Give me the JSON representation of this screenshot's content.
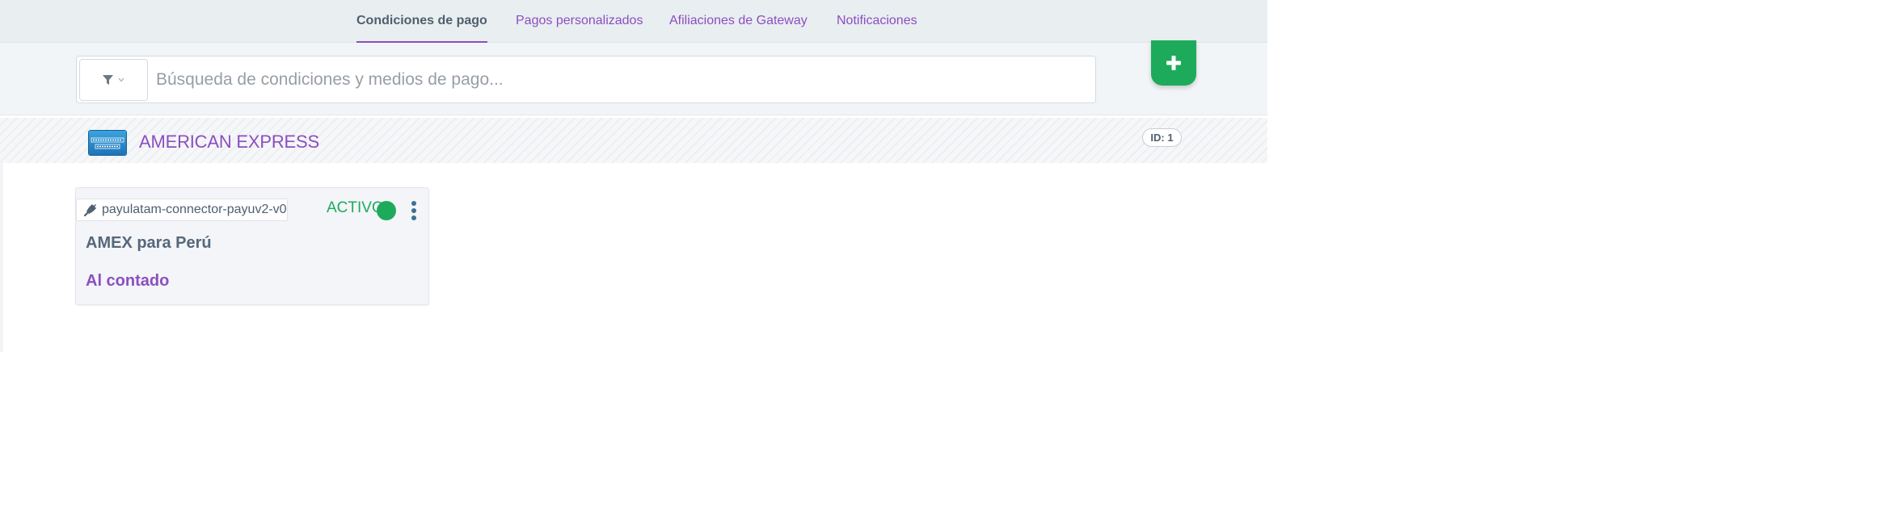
{
  "nav": {
    "tabs": [
      {
        "label": "Condiciones de pago",
        "active": true
      },
      {
        "label": "Pagos personalizados",
        "active": false
      },
      {
        "label": "Afiliaciones de Gateway",
        "active": false
      },
      {
        "label": "Notificaciones",
        "active": false
      }
    ]
  },
  "search": {
    "placeholder": "Búsqueda de condiciones y medios de pago...",
    "value": "",
    "filter_icon": "filter-icon"
  },
  "add_button": {
    "icon": "plus-icon",
    "color": "#1eaa5b"
  },
  "brand": {
    "name": "AMERICAN EXPRESS",
    "logo": "amex-logo",
    "id_label": "ID: 1"
  },
  "card": {
    "connector": "payulatam-connector-payuv2-v0",
    "connector_icon": "plug-icon",
    "status": "ACTIVO",
    "status_color": "#1eaa5b",
    "title": "AMEX para Perú",
    "subtitle": "Al contado"
  },
  "colors": {
    "accent": "#8b4fc0",
    "success": "#1eaa5b",
    "text": "#4f5f6e"
  }
}
